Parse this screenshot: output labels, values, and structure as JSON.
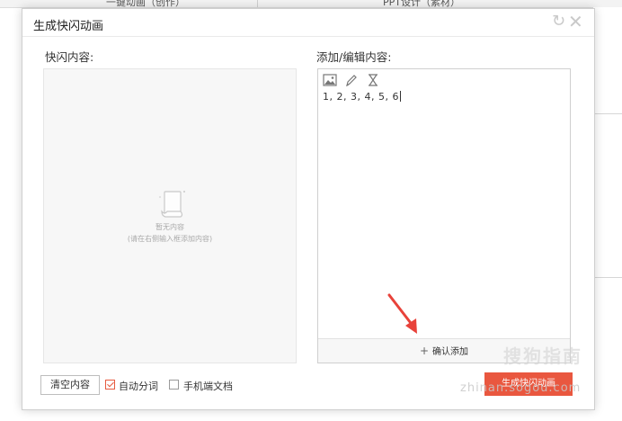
{
  "background": {
    "tabs": [
      "一键动画（创作）",
      "PPT设计（素材）"
    ]
  },
  "dialog": {
    "title": "生成快闪动画",
    "left_label": "快闪内容:",
    "right_label": "添加/编辑内容:",
    "empty_title": "暂无内容",
    "empty_hint": "(请在右侧输入框添加内容)",
    "editor_text": "1, 2, 3, 4, 5, 6",
    "confirm_add": "确认添加",
    "clear_button": "清空内容",
    "auto_split_label": "自动分词",
    "auto_split_checked": true,
    "mobile_doc_label": "手机端文档",
    "mobile_doc_checked": false,
    "generate_button": "生成快闪动画"
  },
  "watermark": {
    "logo_text": "搜狗指南",
    "url": "zhinan.sogou.com"
  },
  "colors": {
    "accent": "#e9573f",
    "arrow": "#e8423a"
  },
  "icons": [
    "refresh-icon",
    "close-icon",
    "image-icon",
    "pen-icon",
    "hourglass-icon",
    "empty-doc-icon",
    "plus-icon",
    "checkmark-icon"
  ]
}
